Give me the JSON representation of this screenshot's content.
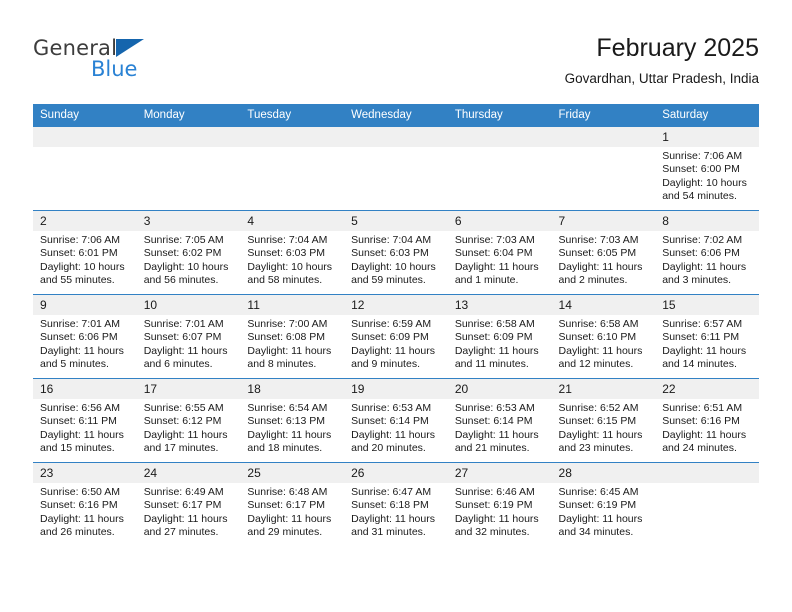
{
  "brand": {
    "name_top": "General",
    "name_bottom": "Blue",
    "triangle_color": "#1565ad",
    "blue_color": "#2a82d4"
  },
  "header": {
    "title": "February 2025",
    "subtitle": "Govardhan, Uttar Pradesh, India"
  },
  "theme": {
    "header_bar": "#3281c4",
    "daynum_band": "#f0f0f0",
    "grid_line": "#3281c4",
    "text": "#1a1a1a"
  },
  "weekdays": [
    "Sunday",
    "Monday",
    "Tuesday",
    "Wednesday",
    "Thursday",
    "Friday",
    "Saturday"
  ],
  "labels": {
    "sunrise_prefix": "Sunrise:",
    "sunset_prefix": "Sunset:",
    "daylight_prefix": "Daylight:"
  },
  "weeks": [
    [
      {
        "day": "",
        "empty": true
      },
      {
        "day": "",
        "empty": true
      },
      {
        "day": "",
        "empty": true
      },
      {
        "day": "",
        "empty": true
      },
      {
        "day": "",
        "empty": true
      },
      {
        "day": "",
        "empty": true
      },
      {
        "day": "1",
        "sunrise": "Sunrise: 7:06 AM",
        "sunset": "Sunset: 6:00 PM",
        "daylight": "Daylight: 10 hours and 54 minutes."
      }
    ],
    [
      {
        "day": "2",
        "sunrise": "Sunrise: 7:06 AM",
        "sunset": "Sunset: 6:01 PM",
        "daylight": "Daylight: 10 hours and 55 minutes."
      },
      {
        "day": "3",
        "sunrise": "Sunrise: 7:05 AM",
        "sunset": "Sunset: 6:02 PM",
        "daylight": "Daylight: 10 hours and 56 minutes."
      },
      {
        "day": "4",
        "sunrise": "Sunrise: 7:04 AM",
        "sunset": "Sunset: 6:03 PM",
        "daylight": "Daylight: 10 hours and 58 minutes."
      },
      {
        "day": "5",
        "sunrise": "Sunrise: 7:04 AM",
        "sunset": "Sunset: 6:03 PM",
        "daylight": "Daylight: 10 hours and 59 minutes."
      },
      {
        "day": "6",
        "sunrise": "Sunrise: 7:03 AM",
        "sunset": "Sunset: 6:04 PM",
        "daylight": "Daylight: 11 hours and 1 minute."
      },
      {
        "day": "7",
        "sunrise": "Sunrise: 7:03 AM",
        "sunset": "Sunset: 6:05 PM",
        "daylight": "Daylight: 11 hours and 2 minutes."
      },
      {
        "day": "8",
        "sunrise": "Sunrise: 7:02 AM",
        "sunset": "Sunset: 6:06 PM",
        "daylight": "Daylight: 11 hours and 3 minutes."
      }
    ],
    [
      {
        "day": "9",
        "sunrise": "Sunrise: 7:01 AM",
        "sunset": "Sunset: 6:06 PM",
        "daylight": "Daylight: 11 hours and 5 minutes."
      },
      {
        "day": "10",
        "sunrise": "Sunrise: 7:01 AM",
        "sunset": "Sunset: 6:07 PM",
        "daylight": "Daylight: 11 hours and 6 minutes."
      },
      {
        "day": "11",
        "sunrise": "Sunrise: 7:00 AM",
        "sunset": "Sunset: 6:08 PM",
        "daylight": "Daylight: 11 hours and 8 minutes."
      },
      {
        "day": "12",
        "sunrise": "Sunrise: 6:59 AM",
        "sunset": "Sunset: 6:09 PM",
        "daylight": "Daylight: 11 hours and 9 minutes."
      },
      {
        "day": "13",
        "sunrise": "Sunrise: 6:58 AM",
        "sunset": "Sunset: 6:09 PM",
        "daylight": "Daylight: 11 hours and 11 minutes."
      },
      {
        "day": "14",
        "sunrise": "Sunrise: 6:58 AM",
        "sunset": "Sunset: 6:10 PM",
        "daylight": "Daylight: 11 hours and 12 minutes."
      },
      {
        "day": "15",
        "sunrise": "Sunrise: 6:57 AM",
        "sunset": "Sunset: 6:11 PM",
        "daylight": "Daylight: 11 hours and 14 minutes."
      }
    ],
    [
      {
        "day": "16",
        "sunrise": "Sunrise: 6:56 AM",
        "sunset": "Sunset: 6:11 PM",
        "daylight": "Daylight: 11 hours and 15 minutes."
      },
      {
        "day": "17",
        "sunrise": "Sunrise: 6:55 AM",
        "sunset": "Sunset: 6:12 PM",
        "daylight": "Daylight: 11 hours and 17 minutes."
      },
      {
        "day": "18",
        "sunrise": "Sunrise: 6:54 AM",
        "sunset": "Sunset: 6:13 PM",
        "daylight": "Daylight: 11 hours and 18 minutes."
      },
      {
        "day": "19",
        "sunrise": "Sunrise: 6:53 AM",
        "sunset": "Sunset: 6:14 PM",
        "daylight": "Daylight: 11 hours and 20 minutes."
      },
      {
        "day": "20",
        "sunrise": "Sunrise: 6:53 AM",
        "sunset": "Sunset: 6:14 PM",
        "daylight": "Daylight: 11 hours and 21 minutes."
      },
      {
        "day": "21",
        "sunrise": "Sunrise: 6:52 AM",
        "sunset": "Sunset: 6:15 PM",
        "daylight": "Daylight: 11 hours and 23 minutes."
      },
      {
        "day": "22",
        "sunrise": "Sunrise: 6:51 AM",
        "sunset": "Sunset: 6:16 PM",
        "daylight": "Daylight: 11 hours and 24 minutes."
      }
    ],
    [
      {
        "day": "23",
        "sunrise": "Sunrise: 6:50 AM",
        "sunset": "Sunset: 6:16 PM",
        "daylight": "Daylight: 11 hours and 26 minutes."
      },
      {
        "day": "24",
        "sunrise": "Sunrise: 6:49 AM",
        "sunset": "Sunset: 6:17 PM",
        "daylight": "Daylight: 11 hours and 27 minutes."
      },
      {
        "day": "25",
        "sunrise": "Sunrise: 6:48 AM",
        "sunset": "Sunset: 6:17 PM",
        "daylight": "Daylight: 11 hours and 29 minutes."
      },
      {
        "day": "26",
        "sunrise": "Sunrise: 6:47 AM",
        "sunset": "Sunset: 6:18 PM",
        "daylight": "Daylight: 11 hours and 31 minutes."
      },
      {
        "day": "27",
        "sunrise": "Sunrise: 6:46 AM",
        "sunset": "Sunset: 6:19 PM",
        "daylight": "Daylight: 11 hours and 32 minutes."
      },
      {
        "day": "28",
        "sunrise": "Sunrise: 6:45 AM",
        "sunset": "Sunset: 6:19 PM",
        "daylight": "Daylight: 11 hours and 34 minutes."
      },
      {
        "day": "",
        "empty": true
      }
    ]
  ]
}
